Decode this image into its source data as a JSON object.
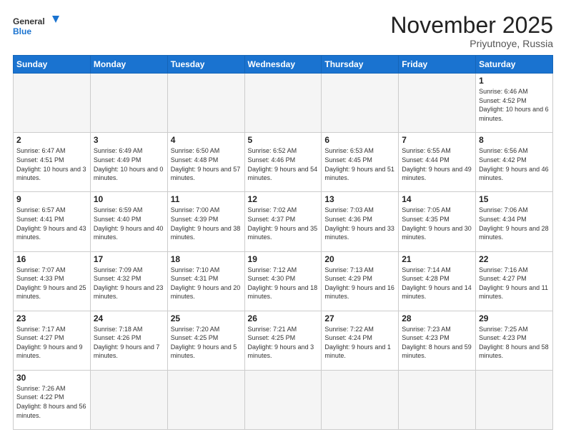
{
  "header": {
    "logo_general": "General",
    "logo_blue": "Blue",
    "month": "November 2025",
    "location": "Priyutnoye, Russia"
  },
  "days_of_week": [
    "Sunday",
    "Monday",
    "Tuesday",
    "Wednesday",
    "Thursday",
    "Friday",
    "Saturday"
  ],
  "weeks": [
    [
      {
        "day": "",
        "info": ""
      },
      {
        "day": "",
        "info": ""
      },
      {
        "day": "",
        "info": ""
      },
      {
        "day": "",
        "info": ""
      },
      {
        "day": "",
        "info": ""
      },
      {
        "day": "",
        "info": ""
      },
      {
        "day": "1",
        "info": "Sunrise: 6:46 AM\nSunset: 4:52 PM\nDaylight: 10 hours and 6 minutes."
      }
    ],
    [
      {
        "day": "2",
        "info": "Sunrise: 6:47 AM\nSunset: 4:51 PM\nDaylight: 10 hours and 3 minutes."
      },
      {
        "day": "3",
        "info": "Sunrise: 6:49 AM\nSunset: 4:49 PM\nDaylight: 10 hours and 0 minutes."
      },
      {
        "day": "4",
        "info": "Sunrise: 6:50 AM\nSunset: 4:48 PM\nDaylight: 9 hours and 57 minutes."
      },
      {
        "day": "5",
        "info": "Sunrise: 6:52 AM\nSunset: 4:46 PM\nDaylight: 9 hours and 54 minutes."
      },
      {
        "day": "6",
        "info": "Sunrise: 6:53 AM\nSunset: 4:45 PM\nDaylight: 9 hours and 51 minutes."
      },
      {
        "day": "7",
        "info": "Sunrise: 6:55 AM\nSunset: 4:44 PM\nDaylight: 9 hours and 49 minutes."
      },
      {
        "day": "8",
        "info": "Sunrise: 6:56 AM\nSunset: 4:42 PM\nDaylight: 9 hours and 46 minutes."
      }
    ],
    [
      {
        "day": "9",
        "info": "Sunrise: 6:57 AM\nSunset: 4:41 PM\nDaylight: 9 hours and 43 minutes."
      },
      {
        "day": "10",
        "info": "Sunrise: 6:59 AM\nSunset: 4:40 PM\nDaylight: 9 hours and 40 minutes."
      },
      {
        "day": "11",
        "info": "Sunrise: 7:00 AM\nSunset: 4:39 PM\nDaylight: 9 hours and 38 minutes."
      },
      {
        "day": "12",
        "info": "Sunrise: 7:02 AM\nSunset: 4:37 PM\nDaylight: 9 hours and 35 minutes."
      },
      {
        "day": "13",
        "info": "Sunrise: 7:03 AM\nSunset: 4:36 PM\nDaylight: 9 hours and 33 minutes."
      },
      {
        "day": "14",
        "info": "Sunrise: 7:05 AM\nSunset: 4:35 PM\nDaylight: 9 hours and 30 minutes."
      },
      {
        "day": "15",
        "info": "Sunrise: 7:06 AM\nSunset: 4:34 PM\nDaylight: 9 hours and 28 minutes."
      }
    ],
    [
      {
        "day": "16",
        "info": "Sunrise: 7:07 AM\nSunset: 4:33 PM\nDaylight: 9 hours and 25 minutes."
      },
      {
        "day": "17",
        "info": "Sunrise: 7:09 AM\nSunset: 4:32 PM\nDaylight: 9 hours and 23 minutes."
      },
      {
        "day": "18",
        "info": "Sunrise: 7:10 AM\nSunset: 4:31 PM\nDaylight: 9 hours and 20 minutes."
      },
      {
        "day": "19",
        "info": "Sunrise: 7:12 AM\nSunset: 4:30 PM\nDaylight: 9 hours and 18 minutes."
      },
      {
        "day": "20",
        "info": "Sunrise: 7:13 AM\nSunset: 4:29 PM\nDaylight: 9 hours and 16 minutes."
      },
      {
        "day": "21",
        "info": "Sunrise: 7:14 AM\nSunset: 4:28 PM\nDaylight: 9 hours and 14 minutes."
      },
      {
        "day": "22",
        "info": "Sunrise: 7:16 AM\nSunset: 4:27 PM\nDaylight: 9 hours and 11 minutes."
      }
    ],
    [
      {
        "day": "23",
        "info": "Sunrise: 7:17 AM\nSunset: 4:27 PM\nDaylight: 9 hours and 9 minutes."
      },
      {
        "day": "24",
        "info": "Sunrise: 7:18 AM\nSunset: 4:26 PM\nDaylight: 9 hours and 7 minutes."
      },
      {
        "day": "25",
        "info": "Sunrise: 7:20 AM\nSunset: 4:25 PM\nDaylight: 9 hours and 5 minutes."
      },
      {
        "day": "26",
        "info": "Sunrise: 7:21 AM\nSunset: 4:25 PM\nDaylight: 9 hours and 3 minutes."
      },
      {
        "day": "27",
        "info": "Sunrise: 7:22 AM\nSunset: 4:24 PM\nDaylight: 9 hours and 1 minute."
      },
      {
        "day": "28",
        "info": "Sunrise: 7:23 AM\nSunset: 4:23 PM\nDaylight: 8 hours and 59 minutes."
      },
      {
        "day": "29",
        "info": "Sunrise: 7:25 AM\nSunset: 4:23 PM\nDaylight: 8 hours and 58 minutes."
      }
    ],
    [
      {
        "day": "30",
        "info": "Sunrise: 7:26 AM\nSunset: 4:22 PM\nDaylight: 8 hours and 56 minutes."
      },
      {
        "day": "",
        "info": ""
      },
      {
        "day": "",
        "info": ""
      },
      {
        "day": "",
        "info": ""
      },
      {
        "day": "",
        "info": ""
      },
      {
        "day": "",
        "info": ""
      },
      {
        "day": "",
        "info": ""
      }
    ]
  ]
}
